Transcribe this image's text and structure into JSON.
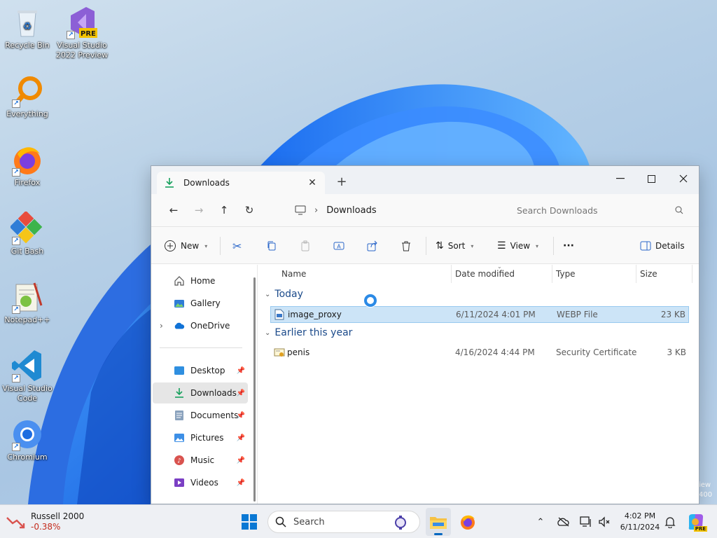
{
  "desktop": {
    "icons": [
      {
        "label": "Recycle Bin"
      },
      {
        "label": "Visual Studio 2022 Preview",
        "badge": "PRE"
      },
      {
        "label": "Everything"
      },
      {
        "label": "Firefox"
      },
      {
        "label": "Git Bash"
      },
      {
        "label": "Notepad++"
      },
      {
        "label": "Visual Studio Code"
      },
      {
        "label": "Chromium"
      }
    ],
    "watermark": "iew\n400"
  },
  "explorer": {
    "tab_title": "Downloads",
    "tab_icon": "download-icon",
    "address": {
      "location": "Downloads"
    },
    "search": {
      "placeholder": "Search Downloads"
    },
    "toolbar": {
      "new_label": "New",
      "sort_label": "Sort",
      "view_label": "View",
      "more_label": "···",
      "details_label": "Details"
    },
    "nav": {
      "items": [
        {
          "label": "Home",
          "icon": "home-icon"
        },
        {
          "label": "Gallery",
          "icon": "gallery-icon"
        },
        {
          "label": "OneDrive",
          "icon": "cloud-icon"
        },
        {
          "label": "Desktop",
          "icon": "desktop-folder-icon"
        },
        {
          "label": "Downloads",
          "icon": "download-icon"
        },
        {
          "label": "Documents",
          "icon": "documents-icon"
        },
        {
          "label": "Pictures",
          "icon": "pictures-icon"
        },
        {
          "label": "Music",
          "icon": "music-icon"
        },
        {
          "label": "Videos",
          "icon": "videos-icon"
        }
      ]
    },
    "columns": {
      "name": "Name",
      "date": "Date modified",
      "type": "Type",
      "size": "Size"
    },
    "groups": [
      {
        "title": "Today",
        "files": [
          {
            "name": "image_proxy",
            "date": "6/11/2024 4:01 PM",
            "type": "WEBP File",
            "size": "23 KB",
            "selected": true
          }
        ]
      },
      {
        "title": "Earlier this year",
        "files": [
          {
            "name": "penis",
            "date": "4/16/2024 4:44 PM",
            "type": "Security Certificate",
            "size": "3 KB",
            "selected": false
          }
        ]
      }
    ]
  },
  "taskbar": {
    "widget": {
      "name": "Russell 2000",
      "change": "-0.38%",
      "change_color": "#c42b1c"
    },
    "search_label": "Search",
    "clock": {
      "time": "4:02 PM",
      "date": "6/11/2024"
    }
  },
  "colors": {
    "accent": "#0067c0",
    "selection": "#cce4f7"
  }
}
